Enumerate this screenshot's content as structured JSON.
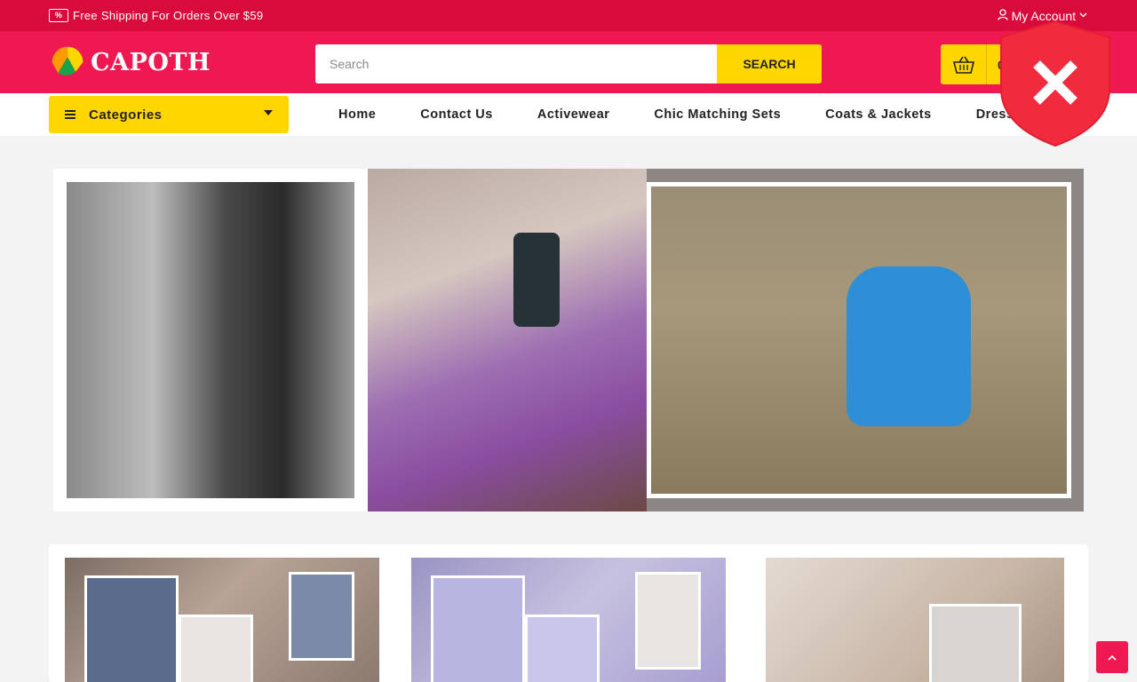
{
  "topbar": {
    "promo_text": "Free Shipping For Orders Over $59",
    "promo_icon": "discount-ticket-icon",
    "account_label": "My Account"
  },
  "header": {
    "brand": "CAPOTH",
    "search": {
      "placeholder": "Search",
      "button_label": "SEARCH"
    },
    "cart_text": "0"
  },
  "nav": {
    "categories_label": "Categories",
    "menu": [
      "Home",
      "Contact Us",
      "Activewear",
      "Chic Matching Sets",
      "Coats & Jackets",
      "Dresses"
    ]
  },
  "colors": {
    "topbar": "#d80b3c",
    "header": "#ef1850",
    "accent": "#ffd600",
    "shield": "#ef2b3d"
  },
  "icons": {
    "account": "user-icon",
    "cart": "basket-icon",
    "security": "shield-x-icon",
    "back_to_top": "chevron-up-icon"
  }
}
